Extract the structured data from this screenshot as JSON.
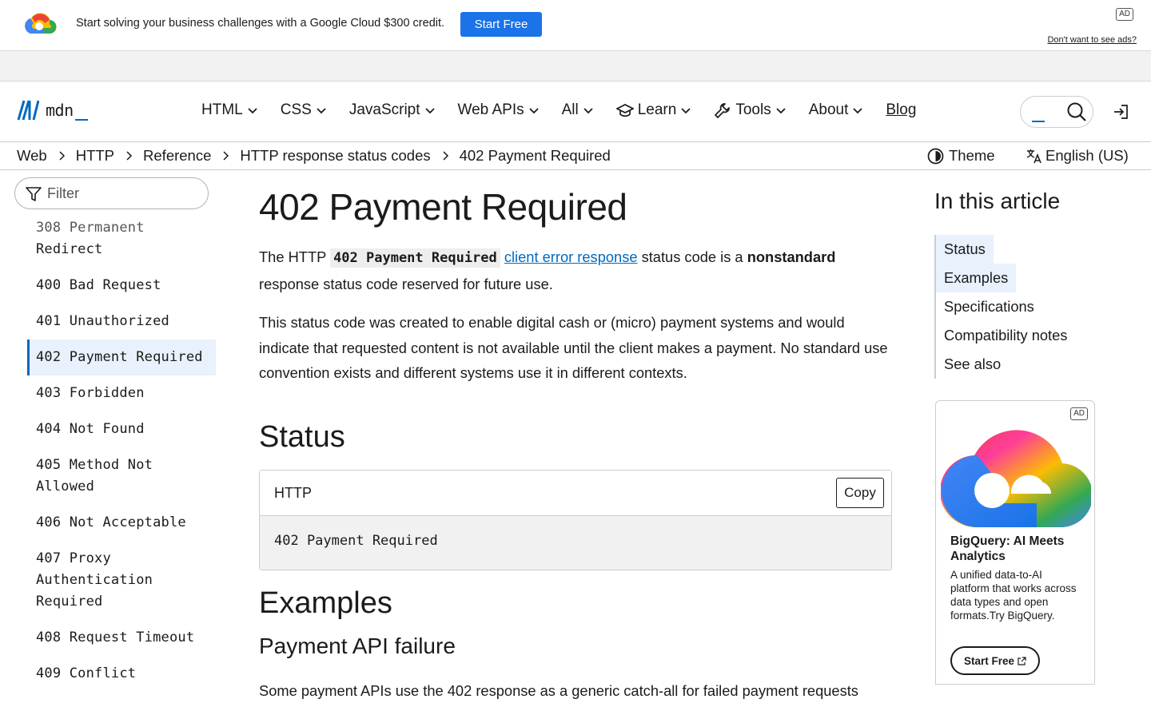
{
  "ad_banner": {
    "text": "Start solving your business challenges with a Google Cloud $300 credit.",
    "cta": "Start Free",
    "badge": "AD",
    "dismiss": "Don't want to see ads?"
  },
  "header": {
    "logo_text": "mdn",
    "nav": [
      {
        "label": "HTML"
      },
      {
        "label": "CSS"
      },
      {
        "label": "JavaScript"
      },
      {
        "label": "Web APIs"
      },
      {
        "label": "All"
      },
      {
        "label": "Learn"
      },
      {
        "label": "Tools"
      },
      {
        "label": "About"
      },
      {
        "label": "Blog"
      }
    ]
  },
  "breadcrumbs": [
    "Web",
    "HTTP",
    "Reference",
    "HTTP response status codes",
    "402 Payment Required"
  ],
  "toolbar": {
    "theme": "Theme",
    "language": "English (US)"
  },
  "sidebar": {
    "filter_placeholder": "Filter",
    "items": [
      {
        "line1": "308 Permanent",
        "line2": "Redirect"
      },
      {
        "line1": "400 Bad Request"
      },
      {
        "line1": "401 Unauthorized"
      },
      {
        "line1": "402 Payment Required"
      },
      {
        "line1": "403 Forbidden"
      },
      {
        "line1": "404 Not Found"
      },
      {
        "line1": "405 Method Not",
        "line2": "Allowed"
      },
      {
        "line1": "406 Not Acceptable"
      },
      {
        "line1": "407 Proxy",
        "line2": "Authentication",
        "line3": "Required"
      },
      {
        "line1": "408 Request Timeout"
      },
      {
        "line1": "409 Conflict"
      }
    ]
  },
  "article": {
    "title": "402 Payment Required",
    "intro_p1_a": "The HTTP ",
    "intro_p1_code": "402 Payment Required",
    "intro_p1_link": "client error response",
    "intro_p1_b": " status code is a ",
    "intro_p1_bold": "nonstandard",
    "intro_p1_c": "response status code reserved for future use.",
    "intro_p2": "This status code was created to enable digital cash or (micro) payment systems and would indicate that requested content is not available until the client makes a payment. No standard use convention exists and different systems use it in different contexts.",
    "status_heading": "Status",
    "code_lang": "HTTP",
    "copy_label": "Copy",
    "code_line": "402 Payment Required",
    "examples_heading": "Examples",
    "sub_heading": "Payment API failure",
    "cut_line": "Some payment APIs use the 402 response as a generic catch-all for failed payment requests"
  },
  "toc": {
    "heading": "In this article",
    "items": [
      "Status",
      "Examples",
      "Specifications",
      "Compatibility notes",
      "See also"
    ]
  },
  "side_ad": {
    "badge": "AD",
    "headline": "BigQuery: AI Meets Analytics",
    "description": "A unified data-to-AI platform that works across data types and open formats.Try BigQuery.",
    "cta": "Start Free"
  },
  "colors": {
    "accent": "#0069c2",
    "google_blue": "#1a73e8",
    "highlight": "#e8f1fc"
  }
}
